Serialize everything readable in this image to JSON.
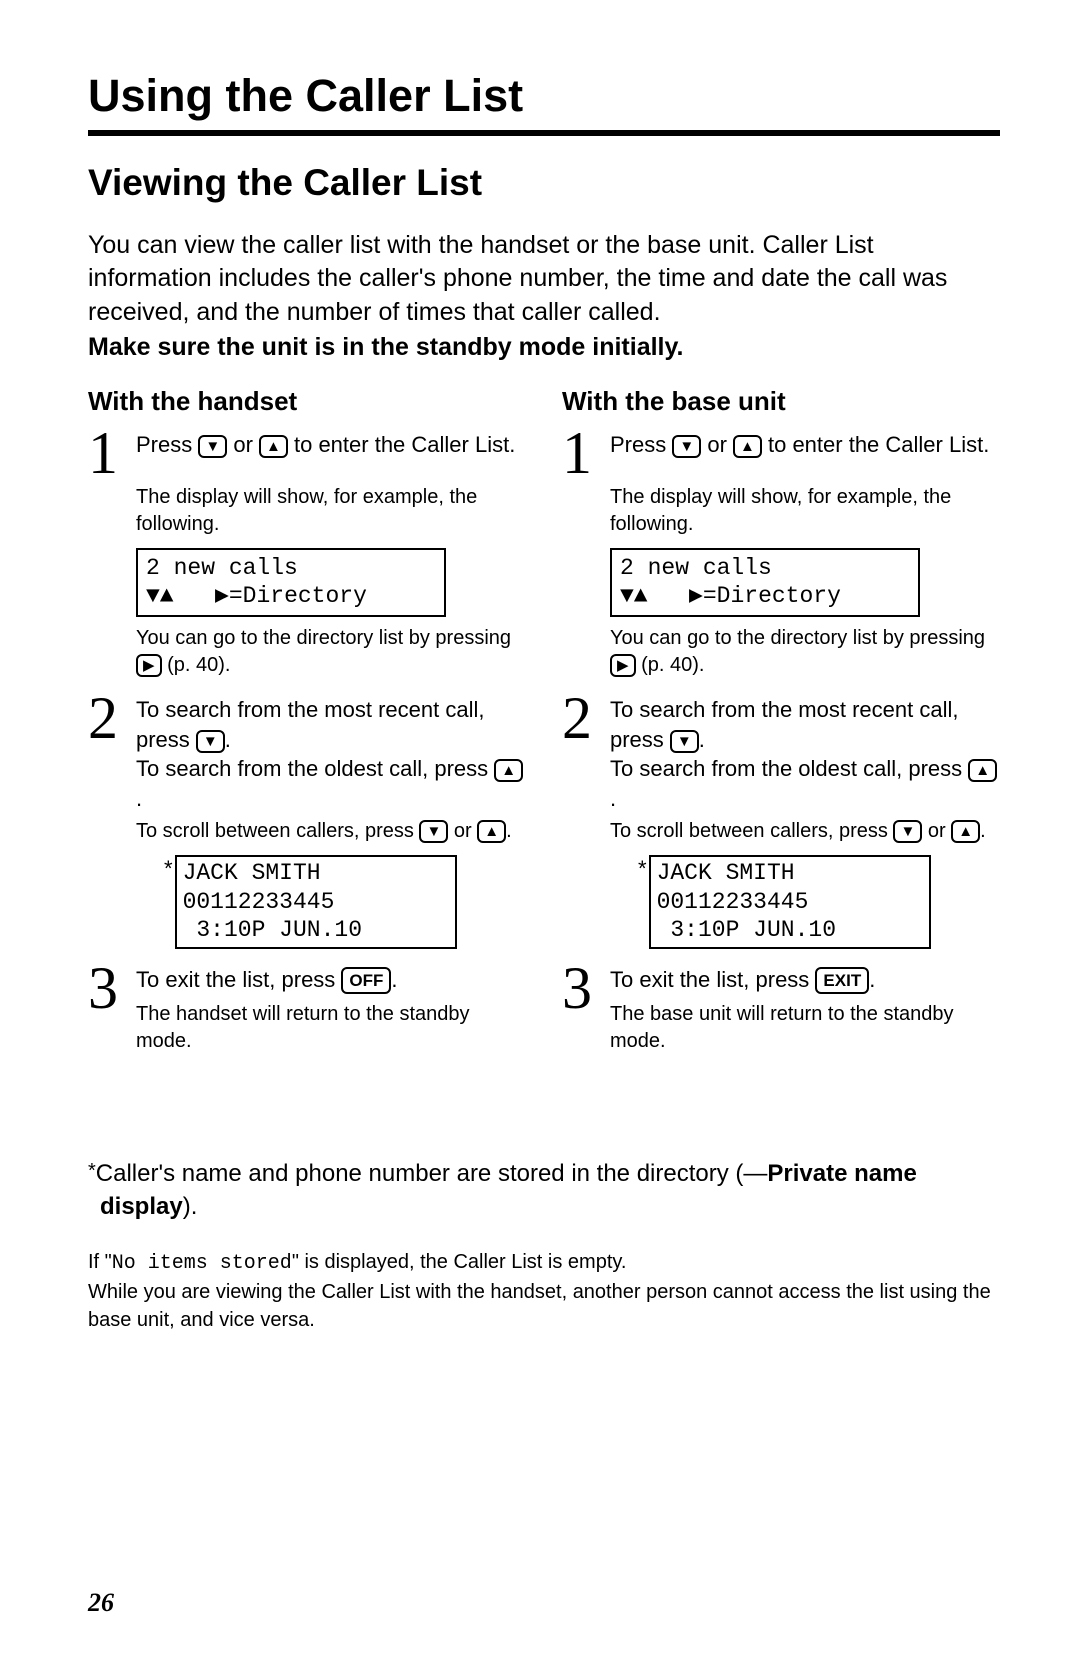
{
  "title": "Using the Caller List",
  "section": "Viewing the Caller List",
  "intro": "You can view the caller list with the handset or the base unit. Caller List information includes the caller's phone number, the time and date the call was received, and the number of times that caller called.",
  "standby": "Make sure the unit is in the standby mode initially.",
  "handset": {
    "header": "With the handset",
    "step1": {
      "a": "Press ",
      "b": " or ",
      "c": " to enter the Caller List."
    },
    "note1": "The display will show, for example, the following.",
    "display1": "2 new calls\n▼▲   ▶=Directory",
    "note2a": "You can go to the directory list by pressing ",
    "note2b": " (p. 40).",
    "step2": {
      "a": "To search from the most recent call, press ",
      "b": ".",
      "c": "To search from the oldest call, press ",
      "d": "."
    },
    "note3a": "To scroll between callers, press ",
    "note3b": " or ",
    "note3c": ".",
    "caller": "JACK SMITH\n00112233445\n 3:10P JUN.10",
    "step3": {
      "a": "To exit the list, press ",
      "b": "."
    },
    "exitKey": "OFF",
    "note4": "The handset will return to the standby mode."
  },
  "baseunit": {
    "header": "With the base unit",
    "step1": {
      "a": "Press ",
      "b": " or ",
      "c": " to enter the Caller List."
    },
    "note1": "The display will show, for example, the following.",
    "display1": "2 new calls\n▼▲   ▶=Directory",
    "note2a": "You can go to the directory list by pressing ",
    "note2b": " (p. 40).",
    "step2": {
      "a": "To search from the most recent call, press ",
      "b": ".",
      "c": "To search from the oldest call, press ",
      "d": "."
    },
    "note3a": "To scroll between callers, press ",
    "note3b": " or ",
    "note3c": ".",
    "caller": "JACK SMITH\n00112233445\n 3:10P JUN.10",
    "step3": {
      "a": "To exit the list, press ",
      "b": "."
    },
    "exitKey": "EXIT",
    "note4": "The base unit will return to the standby mode."
  },
  "footnote": {
    "ast": "*",
    "a": "Caller's name and phone number are stored in the directory (—",
    "b": "Private name display",
    "c": ")."
  },
  "bottom": {
    "a": "If \"",
    "code": "No items stored",
    "b": "\" is displayed, the Caller List is empty.",
    "c": "While you are viewing the Caller List with the handset, another person cannot access the list using the base unit, and vice versa."
  },
  "page": "26",
  "keys": {
    "down": "▼",
    "up": "▲",
    "right": "▶"
  }
}
